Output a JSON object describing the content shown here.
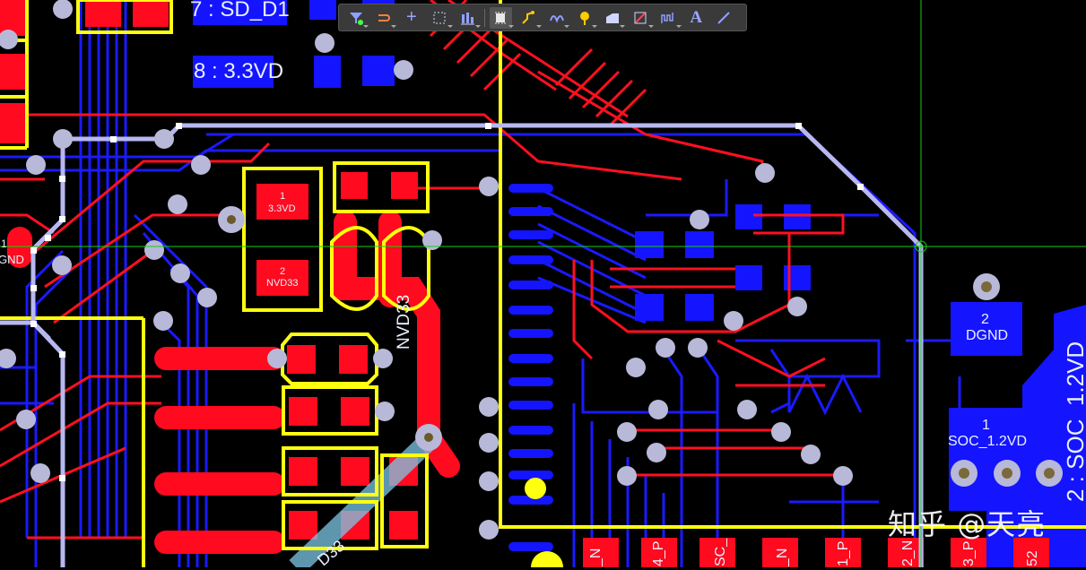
{
  "toolbar": {
    "buttons": [
      {
        "name": "filter-icon"
      },
      {
        "name": "route-select-icon"
      },
      {
        "name": "add-icon",
        "glyph": "+"
      },
      {
        "name": "select-rect-icon"
      },
      {
        "name": "align-icon"
      },
      {
        "name": "component-icon"
      },
      {
        "name": "interactive-route-icon"
      },
      {
        "name": "diff-pair-icon"
      },
      {
        "name": "via-icon"
      },
      {
        "name": "polygon-icon"
      },
      {
        "name": "keepout-icon"
      },
      {
        "name": "length-tune-icon"
      },
      {
        "name": "text-icon",
        "glyph": "A"
      },
      {
        "name": "line-icon"
      }
    ]
  },
  "nets": {
    "sd_d1": "7 : SD_D1",
    "vd33": "8 : 3.3VD",
    "pad1_num": "1",
    "pad1_net": "3.3VD",
    "pad2_num": "2",
    "pad2_net": "NVD33",
    "trace_nvd33": "NVD33",
    "left_gnd_num": "1",
    "left_gnd": "GND",
    "dgnd_num": "2",
    "dgnd": "DGND",
    "soc_num": "1",
    "soc_net": "SOC_1.2VD",
    "soc_right": "2 : SOC_1.2VD",
    "diag_label": "D33"
  },
  "bottom_labels": [
    "_N",
    "4_P",
    "SC_",
    "_N",
    "1_P",
    "2_N",
    "3_P",
    "52"
  ],
  "watermark": "知乎 @天亮",
  "colors": {
    "top_layer": "#ff0a1e",
    "bottom_layer": "#1414ff",
    "silkscreen": "#ffff00",
    "selection": "#b4b4ff",
    "cursor": "#00ff00"
  }
}
